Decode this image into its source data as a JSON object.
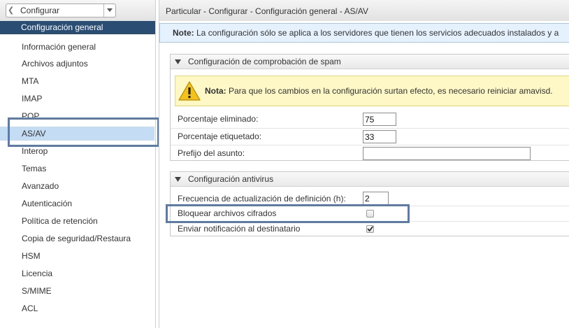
{
  "nav": {
    "back_label": "Configurar",
    "header": "Configuración general",
    "items": [
      "Información general",
      "Archivos adjuntos",
      "MTA",
      "IMAP",
      "POP",
      "AS/AV",
      "Interop",
      "Temas",
      "Avanzado",
      "Autenticación",
      "Política de retención",
      "Copia de seguridad/Restaura",
      "HSM",
      "Licencia",
      "S/MIME",
      "ACL"
    ],
    "selected": "AS/AV"
  },
  "page": {
    "title": "Particular - Configurar - Configuración general - AS/AV",
    "note_label": "Note:",
    "note_text": " La configuración sólo se aplica a los servidores que tienen los servicios adecuados instalados y a"
  },
  "spam": {
    "title": "Configuración de comprobación de spam",
    "warning_label": "Nota:",
    "warning_text": " Para que los cambios en la configuración surtan efecto, es necesario reiniciar amavisd.",
    "kill_percent_label": "Porcentaje eliminado:",
    "kill_percent_value": "75",
    "tag_percent_label": "Porcentaje etiquetado:",
    "tag_percent_value": "33",
    "subject_prefix_label": "Prefijo del asunto:",
    "subject_prefix_value": ""
  },
  "antivirus": {
    "title": "Configuración antivirus",
    "update_freq_label": "Frecuencia de actualización de definición (h):",
    "update_freq_value": "2",
    "block_encrypted_label": "Bloquear archivos cifrados",
    "block_encrypted_checked": false,
    "notify_recipient_label": "Enviar notificación al destinatario",
    "notify_recipient_checked": true
  },
  "colors": {
    "nav_header_bg": "#2a4d74",
    "nav_selected_bg": "#c5dcf5",
    "highlight_frame": "#5b7bab",
    "note_bg": "#e5f1fc",
    "warning_bg": "#fdf8c6"
  }
}
